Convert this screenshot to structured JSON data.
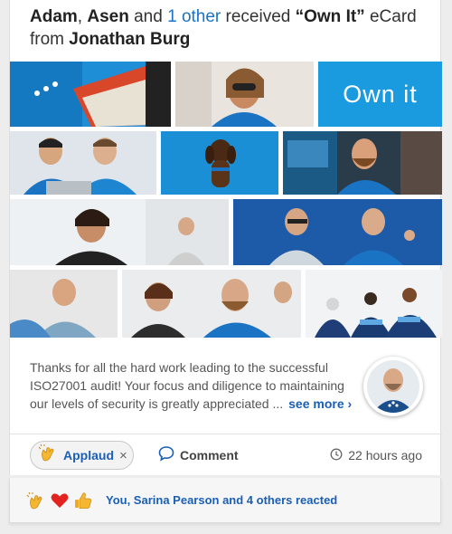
{
  "header": {
    "name1": "Adam",
    "sep": ", ",
    "name2": "Asen",
    "and": " and ",
    "others_link": "1 other",
    "received": " received ",
    "ecard_name": "“Own It”",
    "ecard_word": " eCard",
    "from": "from ",
    "sender": "Jonathan Burg"
  },
  "ecard": {
    "tile_text": "Own it",
    "accent_color": "#1a9be0"
  },
  "message": {
    "text": "Thanks for all the hard work leading to the successful ISO27001 audit! Your focus and diligence to maintaining our levels of security is greatly appreciated ...",
    "see_more": "see more ›"
  },
  "actions": {
    "applaud_label": "Applaud",
    "applaud_remove": "×",
    "comment_label": "Comment",
    "timestamp": "22 hours ago"
  },
  "reactions": {
    "icons": [
      "clapping-hands-icon",
      "heart-icon",
      "thumbs-up-icon"
    ],
    "summary": "You, Sarina Pearson and 4 others reacted"
  },
  "colors": {
    "link": "#1a73c6",
    "bold_link": "#1a5fb4",
    "brand_blue": "#1a9be0"
  }
}
